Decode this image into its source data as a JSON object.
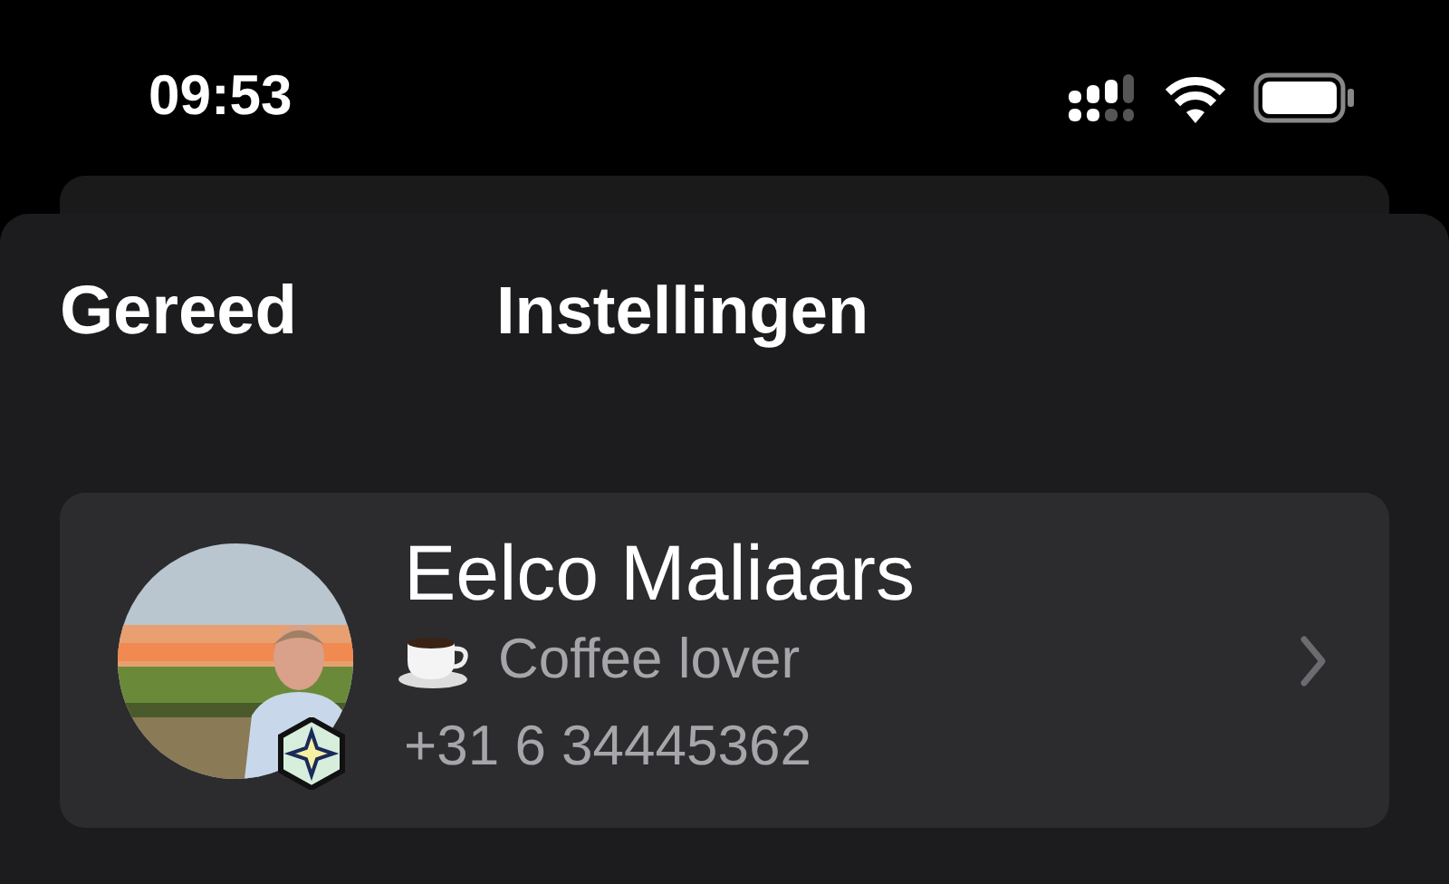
{
  "status_bar": {
    "time": "09:53"
  },
  "nav": {
    "done": "Gereed",
    "title": "Instellingen"
  },
  "profile": {
    "name": "Eelco Maliaars",
    "status": "Coffee lover",
    "phone": "+31 6 34445362"
  }
}
